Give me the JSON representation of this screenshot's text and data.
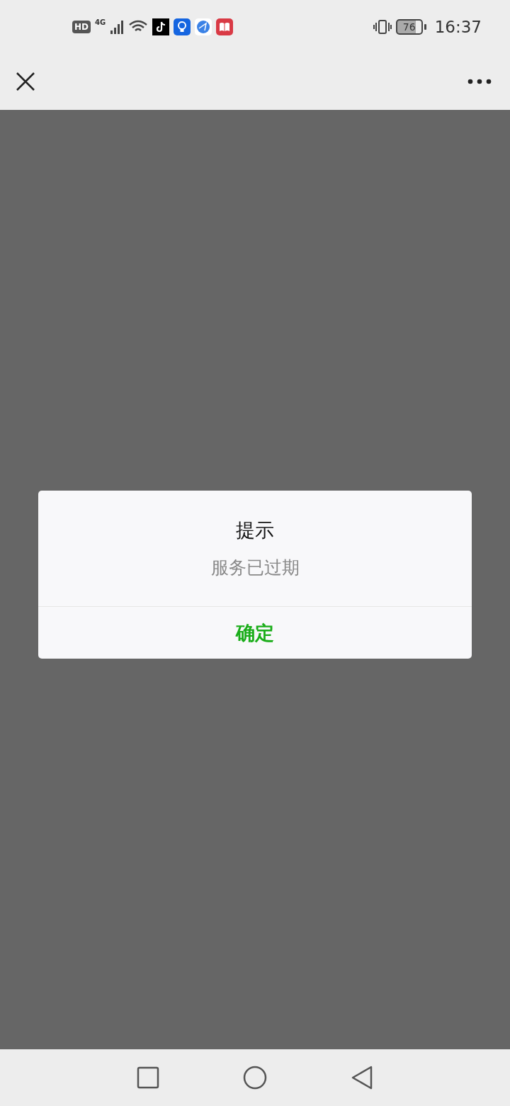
{
  "status_bar": {
    "hd": "HD",
    "network": "4G",
    "battery": "76",
    "time": "16:37"
  },
  "dialog": {
    "title": "提示",
    "message": "服务已过期",
    "buttons": [
      "确定"
    ]
  }
}
